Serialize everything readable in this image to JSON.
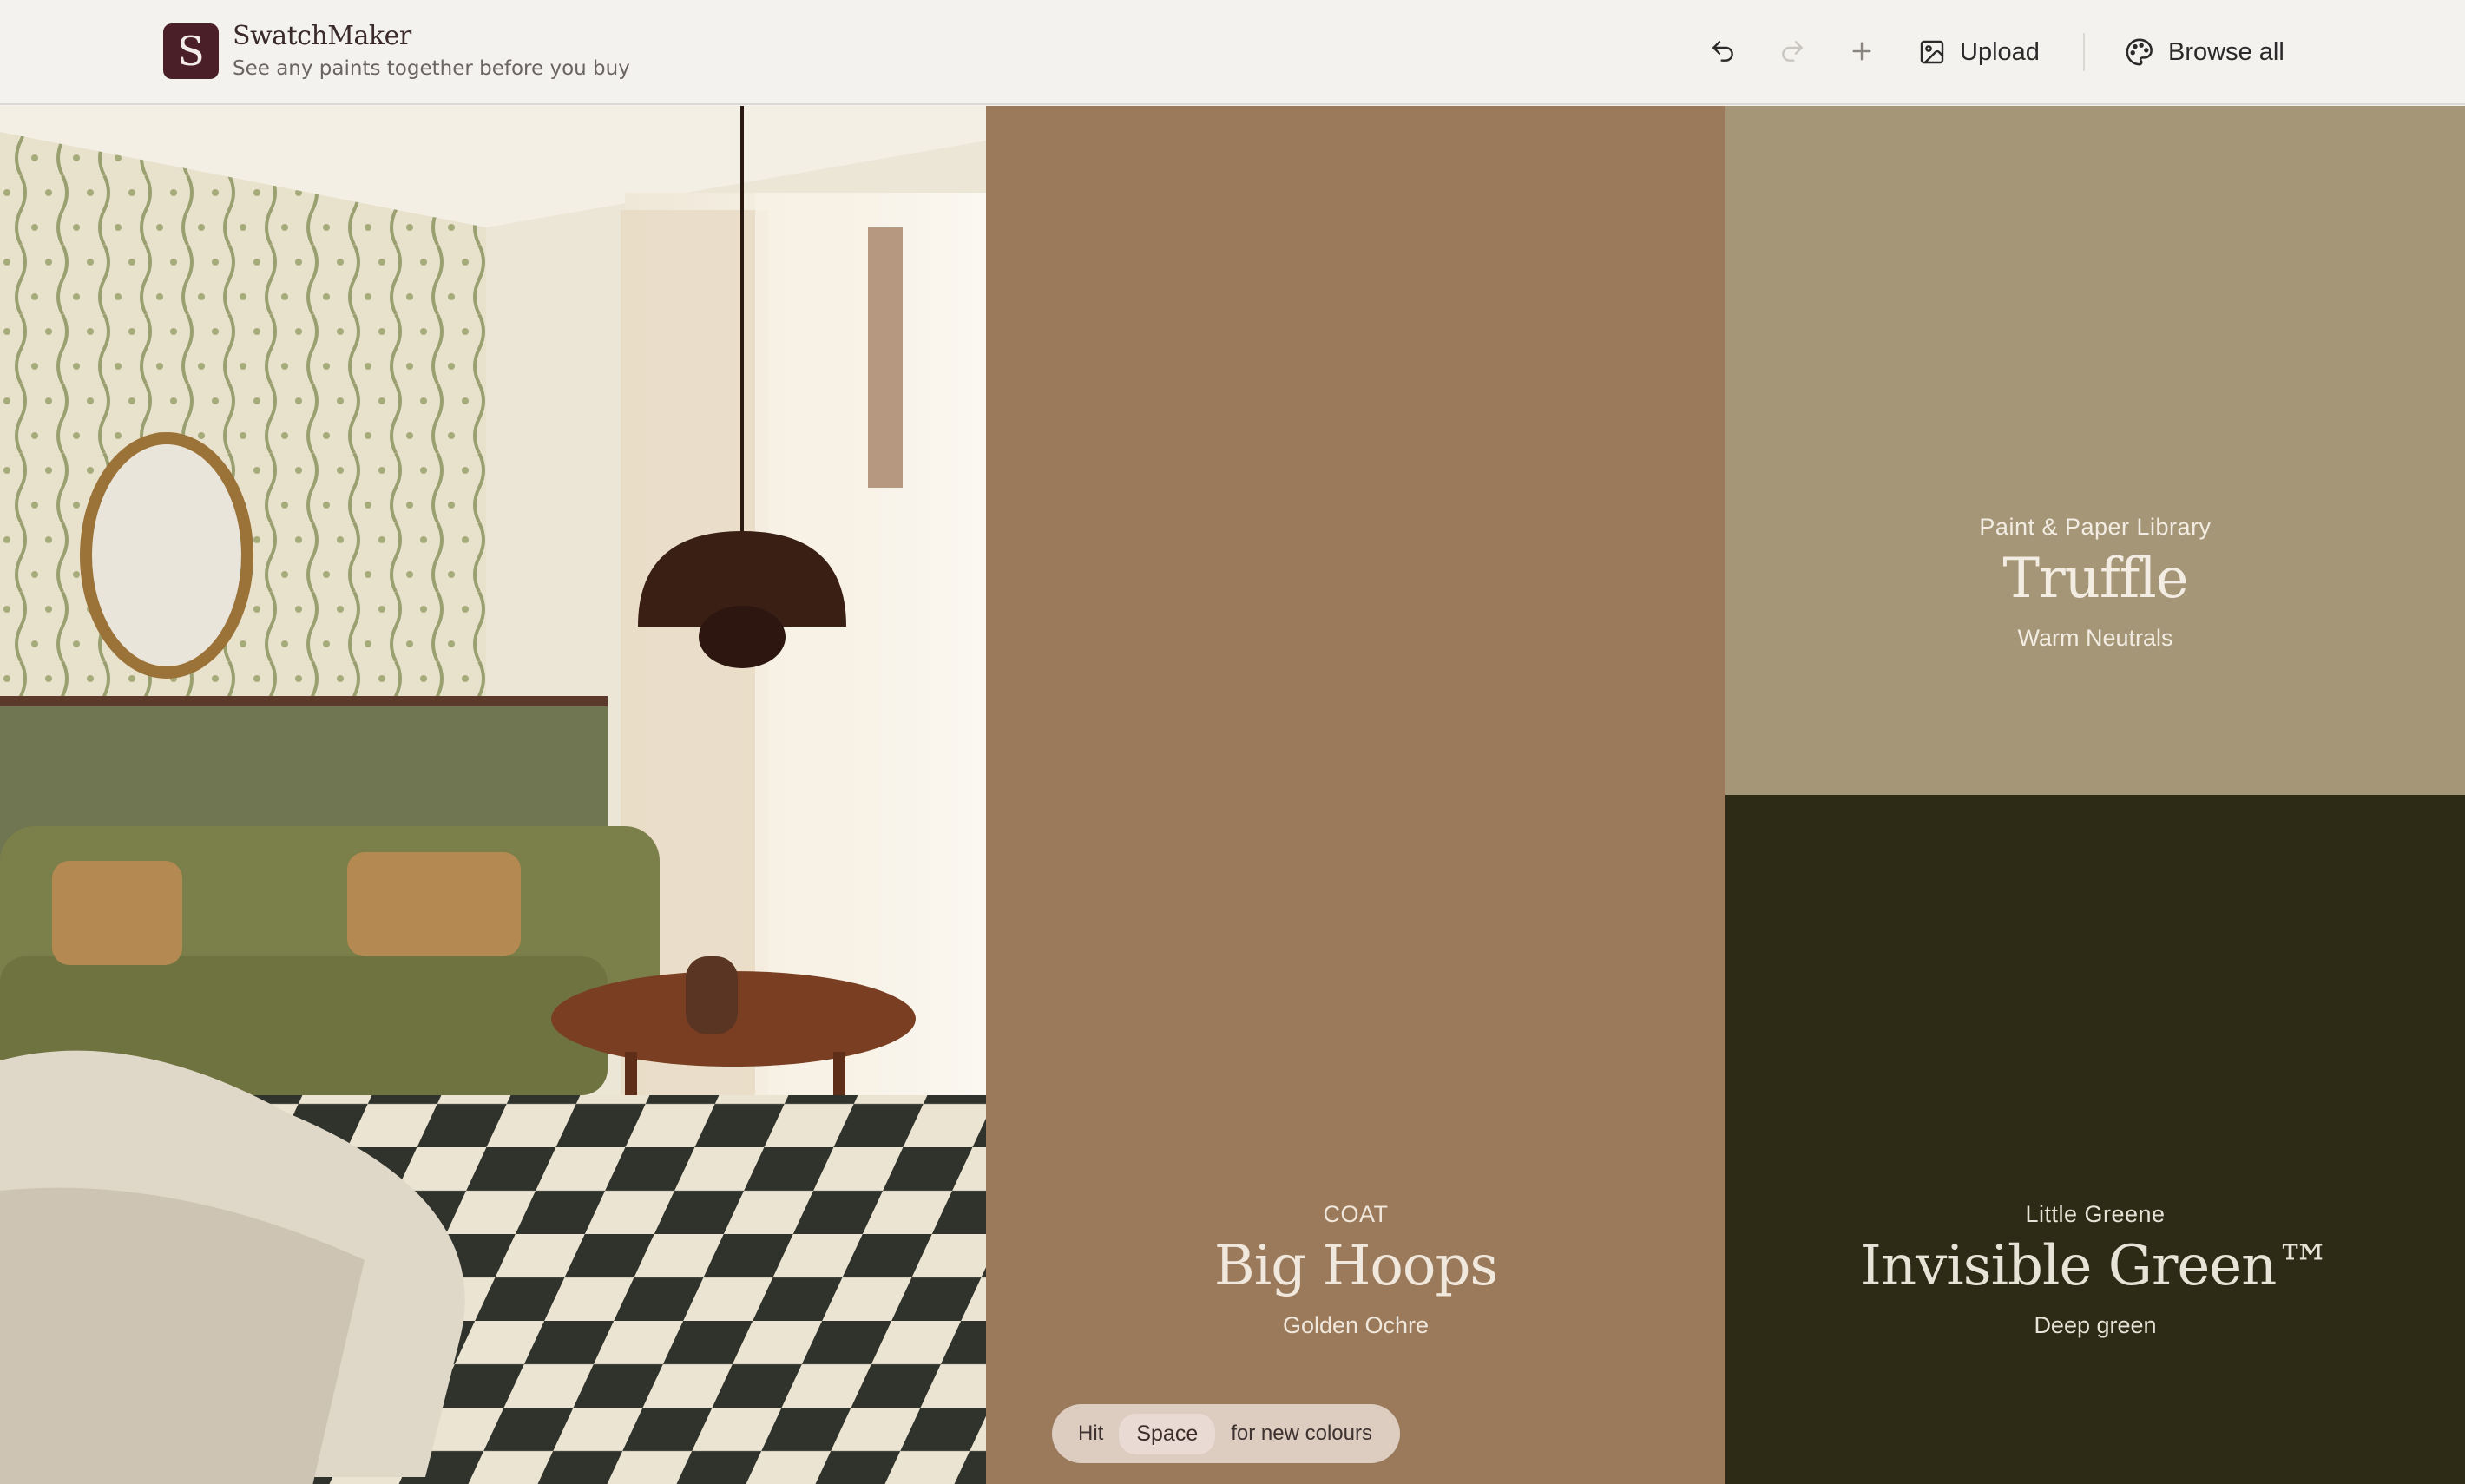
{
  "app": {
    "logo_letter": "S",
    "name": "SwatchMaker",
    "tagline": "See any paints together before you buy"
  },
  "toolbar": {
    "undo_icon": "undo-icon",
    "redo_icon": "redo-icon",
    "add_icon": "plus-icon",
    "upload_label": "Upload",
    "upload_icon": "image-icon",
    "browse_label": "Browse all",
    "browse_icon": "palette-icon"
  },
  "room_image": {
    "subject": "living-room-scene",
    "icon": "sparkle-icon"
  },
  "swatches": [
    {
      "brand": "COAT",
      "name": "Big Hoops",
      "family": "Golden Ochre",
      "color": "#9a7a5a",
      "text_color": "#f0e7dd"
    },
    {
      "brand": "Paint & Paper Library",
      "name": "Truffle",
      "family": "Warm Neutrals",
      "color": "#a59677",
      "text_color": "#f2ece2"
    },
    {
      "brand": "Little Greene",
      "name": "Invisible Green™",
      "family": "Deep green",
      "color": "#2d2b16",
      "text_color": "#e6e3d7"
    }
  ],
  "hint": {
    "prefix": "Hit",
    "key": "Space",
    "suffix": "for new colours"
  }
}
